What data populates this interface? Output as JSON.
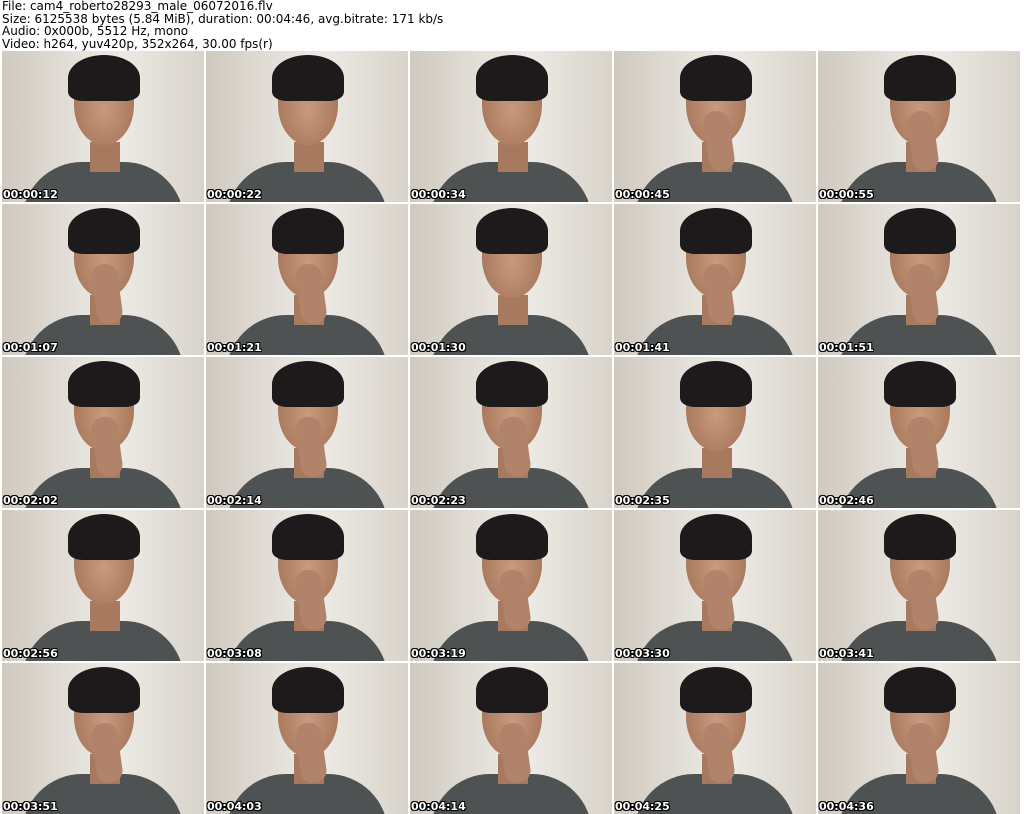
{
  "header": {
    "file": "File: cam4_roberto28293_male_06072016.flv",
    "size": "Size: 6125538 bytes (5.84 MiB), duration: 00:04:46, avg.bitrate: 171 kb/s",
    "audio": "Audio: 0x000b, 5512 Hz, mono",
    "video": "Video: h264, yuv420p, 352x264, 30.00 fps(r)"
  },
  "thumbnails": [
    {
      "time": "00:00:12",
      "hand": false
    },
    {
      "time": "00:00:22",
      "hand": false
    },
    {
      "time": "00:00:34",
      "hand": false
    },
    {
      "time": "00:00:45",
      "hand": true
    },
    {
      "time": "00:00:55",
      "hand": true
    },
    {
      "time": "00:01:07",
      "hand": true
    },
    {
      "time": "00:01:21",
      "hand": true
    },
    {
      "time": "00:01:30",
      "hand": false
    },
    {
      "time": "00:01:41",
      "hand": true
    },
    {
      "time": "00:01:51",
      "hand": true
    },
    {
      "time": "00:02:02",
      "hand": true
    },
    {
      "time": "00:02:14",
      "hand": true
    },
    {
      "time": "00:02:23",
      "hand": true
    },
    {
      "time": "00:02:35",
      "hand": false
    },
    {
      "time": "00:02:46",
      "hand": true
    },
    {
      "time": "00:02:56",
      "hand": false
    },
    {
      "time": "00:03:08",
      "hand": true
    },
    {
      "time": "00:03:19",
      "hand": true
    },
    {
      "time": "00:03:30",
      "hand": true
    },
    {
      "time": "00:03:41",
      "hand": true
    },
    {
      "time": "00:03:51",
      "hand": true
    },
    {
      "time": "00:04:03",
      "hand": true
    },
    {
      "time": "00:04:14",
      "hand": true
    },
    {
      "time": "00:04:25",
      "hand": true
    },
    {
      "time": "00:04:36",
      "hand": true
    }
  ]
}
